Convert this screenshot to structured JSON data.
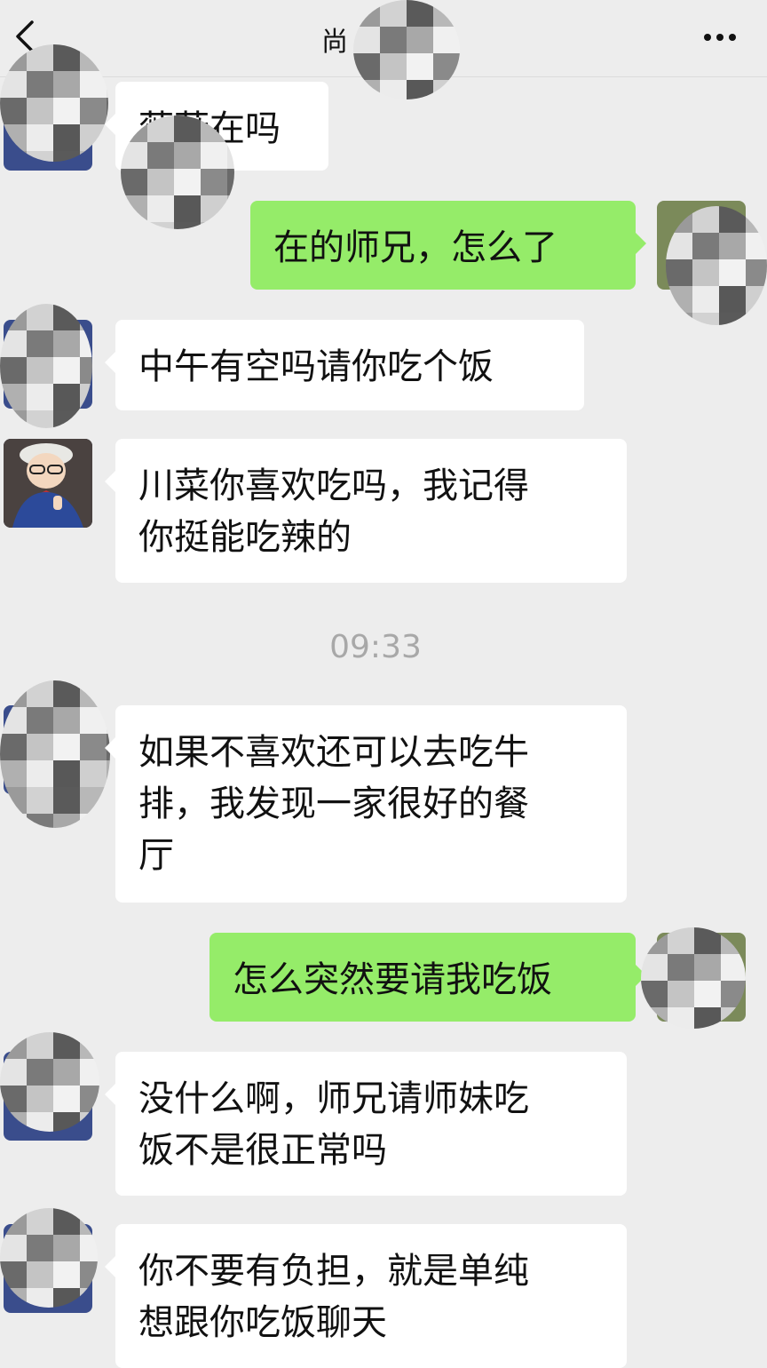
{
  "header": {
    "title": "尚",
    "back_icon": "chevron-left-icon",
    "more_icon": "ellipsis-icon"
  },
  "messages": [
    {
      "side": "in",
      "text": "薇薇在吗"
    },
    {
      "side": "out",
      "text": "在的师兄，怎么了"
    },
    {
      "side": "in",
      "text": "中午有空吗请你吃个饭"
    },
    {
      "side": "in",
      "text": "川菜你喜欢吃吗，我记得\n你挺能吃辣的"
    },
    {
      "side": "in",
      "text": "如果不喜欢还可以去吃牛\n排，我发现一家很好的餐\n厅"
    },
    {
      "side": "out",
      "text": "怎么突然要请我吃饭"
    },
    {
      "side": "in",
      "text": "没什么啊，师兄请师妹吃\n饭不是很正常吗"
    },
    {
      "side": "in",
      "text": "你不要有负担，就是单纯\n想跟你吃饭聊天"
    }
  ],
  "timestamp": "09:33",
  "colors": {
    "background": "#ededed",
    "outgoing_bubble": "#95ec69",
    "incoming_bubble": "#ffffff",
    "timestamp": "#a8a8a8"
  }
}
